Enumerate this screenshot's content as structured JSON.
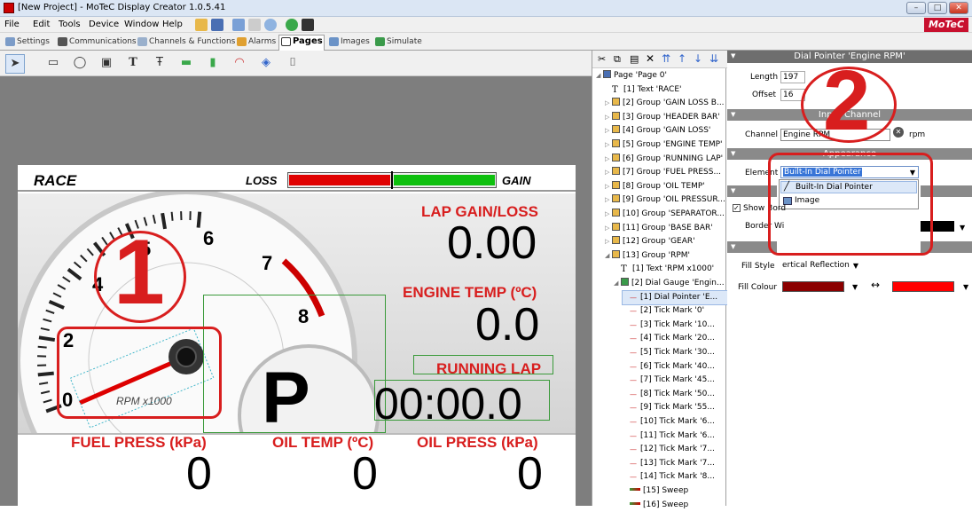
{
  "window": {
    "title": "[New Project] - MoTeC Display Creator 1.0.5.41",
    "brand": "MoTeC"
  },
  "menu": [
    "File",
    "Edit",
    "Tools",
    "Device",
    "Window",
    "Help"
  ],
  "tabs": [
    "Settings",
    "Communications",
    "Channels & Functions",
    "Alarms",
    "Pages",
    "Images",
    "Simulate"
  ],
  "active_tab": "Pages",
  "dashboard": {
    "race": "RACE",
    "loss": "LOSS",
    "gain": "GAIN",
    "lap_gain_label": "LAP GAIN/LOSS",
    "lap_gain_value": "0.00",
    "engine_temp_label": "ENGINE TEMP (ºC)",
    "engine_temp_value": "0.0",
    "running_lap_label": "RUNNING LAP",
    "running_lap_value": "00:00.0",
    "gear": "P",
    "rpm_label": "RPM x1000",
    "rpm_ticks": [
      "0",
      "2",
      "4",
      "5",
      "6",
      "7",
      "8"
    ],
    "fuel_label": "FUEL PRESS (kPa)",
    "fuel_value": "0",
    "oil_temp_label": "OIL TEMP (ºC)",
    "oil_temp_value": "0",
    "oil_press_label": "OIL PRESS (kPa)",
    "oil_press_value": "0"
  },
  "tree": [
    {
      "label": "Page 'Page 0'",
      "indent": 0,
      "icon": "page"
    },
    {
      "label": "[1] Text 'RACE'",
      "indent": 1,
      "icon": "text"
    },
    {
      "label": "[2] Group 'GAIN LOSS B...",
      "indent": 1,
      "icon": "group"
    },
    {
      "label": "[3] Group 'HEADER BAR'",
      "indent": 1,
      "icon": "group"
    },
    {
      "label": "[4] Group 'GAIN LOSS'",
      "indent": 1,
      "icon": "group"
    },
    {
      "label": "[5] Group 'ENGINE TEMP'",
      "indent": 1,
      "icon": "group"
    },
    {
      "label": "[6] Group 'RUNNING LAP'",
      "indent": 1,
      "icon": "group"
    },
    {
      "label": "[7] Group 'FUEL PRESS...",
      "indent": 1,
      "icon": "group"
    },
    {
      "label": "[8] Group 'OIL TEMP'",
      "indent": 1,
      "icon": "group"
    },
    {
      "label": "[9] Group 'OIL PRESSUR...",
      "indent": 1,
      "icon": "group"
    },
    {
      "label": "[10] Group 'SEPARATOR...",
      "indent": 1,
      "icon": "group"
    },
    {
      "label": "[11] Group 'BASE BAR'",
      "indent": 1,
      "icon": "group"
    },
    {
      "label": "[12] Group 'GEAR'",
      "indent": 1,
      "icon": "group"
    },
    {
      "label": "[13] Group 'RPM'",
      "indent": 1,
      "icon": "group"
    },
    {
      "label": "[1] Text 'RPM x1000'",
      "indent": 2,
      "icon": "text"
    },
    {
      "label": "[2] Dial Gauge 'Engin...",
      "indent": 2,
      "icon": "dial"
    },
    {
      "label": "[1] Dial Pointer 'E...",
      "indent": 3,
      "icon": "pointer",
      "selected": true
    },
    {
      "label": "[2] Tick Mark '0'",
      "indent": 3,
      "icon": "tick"
    },
    {
      "label": "[3] Tick Mark '10...",
      "indent": 3,
      "icon": "tick"
    },
    {
      "label": "[4] Tick Mark '20...",
      "indent": 3,
      "icon": "tick"
    },
    {
      "label": "[5] Tick Mark '30...",
      "indent": 3,
      "icon": "tick"
    },
    {
      "label": "[6] Tick Mark '40...",
      "indent": 3,
      "icon": "tick"
    },
    {
      "label": "[7] Tick Mark '45...",
      "indent": 3,
      "icon": "tick"
    },
    {
      "label": "[8] Tick Mark '50...",
      "indent": 3,
      "icon": "tick"
    },
    {
      "label": "[9] Tick Mark '55...",
      "indent": 3,
      "icon": "tick"
    },
    {
      "label": "[10] Tick Mark '6...",
      "indent": 3,
      "icon": "tick"
    },
    {
      "label": "[11] Tick Mark '6...",
      "indent": 3,
      "icon": "tick"
    },
    {
      "label": "[12] Tick Mark '7...",
      "indent": 3,
      "icon": "tick"
    },
    {
      "label": "[13] Tick Mark '7...",
      "indent": 3,
      "icon": "tick"
    },
    {
      "label": "[14] Tick Mark '8...",
      "indent": 3,
      "icon": "tick"
    },
    {
      "label": "[15] Sweep",
      "indent": 3,
      "icon": "sweep"
    },
    {
      "label": "[16] Sweep",
      "indent": 3,
      "icon": "sweep"
    }
  ],
  "props": {
    "header": "Dial Pointer 'Engine RPM'",
    "length_label": "Length",
    "length_value": "197",
    "offset_label": "Offset",
    "offset_value": "16",
    "input_channel_header": "Input Channel",
    "channel_label": "Channel",
    "channel_value": "Engine RPM",
    "channel_unit": "rpm",
    "appearance_header": "Appearance",
    "element_label": "Element",
    "element_value": "Built-In Dial Pointer",
    "dropdown_options": [
      "Built-In Dial Pointer",
      "Image"
    ],
    "show_border_label": "Show Bord",
    "border_width_label": "Border Wi",
    "fill_style_label": "Fill Style",
    "fill_style_value": "ertical Reflection",
    "fill_colour_label": "Fill Colour",
    "fill_color_1": "#8b0000",
    "fill_color_2": "#ff0000"
  },
  "annotations": {
    "one": "1",
    "two": "2"
  }
}
